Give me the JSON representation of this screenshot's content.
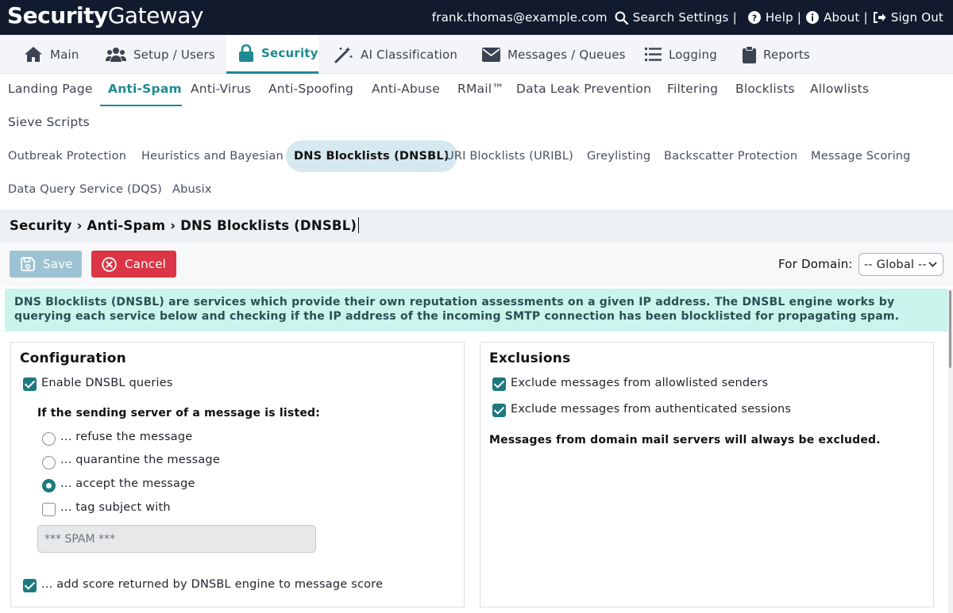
{
  "header": {
    "logo_bold": "Security",
    "logo_light": "Gateway",
    "user_email": "frank.thomas@example.com",
    "search_label": "Search Settings",
    "help_label": "Help",
    "about_label": "About",
    "signout_label": "Sign Out",
    "separator": "|"
  },
  "main_nav": {
    "main": "Main",
    "setup_users": "Setup / Users",
    "security": "Security",
    "ai_classification": "AI Classification",
    "messages_queues": "Messages / Queues",
    "logging": "Logging",
    "reports": "Reports"
  },
  "sub_nav": {
    "landing_page": "Landing Page",
    "anti_spam": "Anti-Spam",
    "anti_virus": "Anti-Virus",
    "anti_spoofing": "Anti-Spoofing",
    "anti_abuse": "Anti-Abuse",
    "rmail": "RMail™",
    "dlp": "Data Leak Prevention",
    "filtering": "Filtering",
    "blocklists": "Blocklists",
    "allowlists": "Allowlists",
    "sieve_scripts": "Sieve Scripts"
  },
  "third_nav": {
    "outbreak": "Outbreak Protection",
    "heuristics": "Heuristics and Bayesian",
    "dnsbl": "DNS Blocklists (DNSBL)",
    "uribl": "URI Blocklists (URIBL)",
    "greylisting": "Greylisting",
    "backscatter": "Backscatter Protection",
    "message_scoring": "Message Scoring",
    "dqs": "Data Query Service (DQS)",
    "abusix": "Abusix"
  },
  "breadcrumb": "Security › Anti-Spam › DNS Blocklists (DNSBL)",
  "toolbar": {
    "save_label": "Save",
    "cancel_label": "Cancel",
    "domain_label": "For Domain:",
    "domain_value": "-- Global --"
  },
  "info_text": "DNS Blocklists (DNSBL) are services which provide their own reputation assessments on a given IP address. The DNSBL engine works by querying each service below and checking if the IP address of the incoming SMTP connection has been blocklisted for propagating spam.",
  "configuration": {
    "title": "Configuration",
    "enable_label": "Enable DNSBL queries",
    "listed_heading": "If the sending server of a message is listed:",
    "refuse_label": "... refuse the message",
    "quarantine_label": "... quarantine the message",
    "accept_label": "... accept the message",
    "tag_label": "... tag subject with",
    "tag_value": "*** SPAM ***",
    "add_score_label": "... add score returned by DNSBL engine to message score"
  },
  "exclusions": {
    "title": "Exclusions",
    "allowlisted_label": "Exclude messages from allowlisted senders",
    "authenticated_label": "Exclude messages from authenticated sessions",
    "note": "Messages from domain mail servers will always be excluded."
  },
  "colors": {
    "topbar": "#121a2e",
    "accent": "#1d8a92",
    "cancel": "#dc3545",
    "save_disabled": "#9dc3d2",
    "info_bg": "#c9f5ec"
  }
}
